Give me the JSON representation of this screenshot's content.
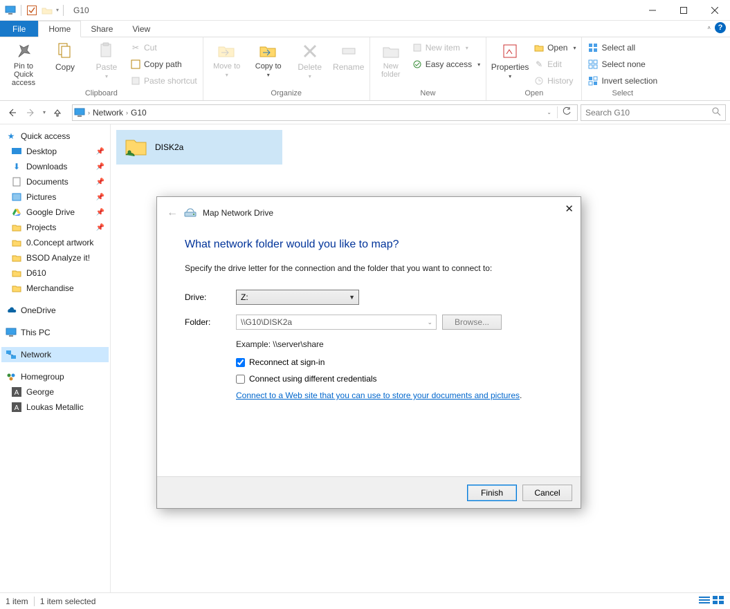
{
  "titlebar": {
    "title": "G10"
  },
  "tabs": {
    "file": "File",
    "home": "Home",
    "share": "Share",
    "view": "View"
  },
  "ribbon": {
    "clipboard": {
      "pin": "Pin to Quick access",
      "copy": "Copy",
      "paste": "Paste",
      "cut": "Cut",
      "copy_path": "Copy path",
      "paste_shortcut": "Paste shortcut",
      "label": "Clipboard"
    },
    "organize": {
      "move": "Move to",
      "copy": "Copy to",
      "delete": "Delete",
      "rename": "Rename",
      "label": "Organize"
    },
    "new": {
      "folder": "New folder",
      "item": "New item",
      "easy": "Easy access",
      "label": "New"
    },
    "open": {
      "properties": "Properties",
      "open": "Open",
      "edit": "Edit",
      "history": "History",
      "label": "Open"
    },
    "select": {
      "all": "Select all",
      "none": "Select none",
      "invert": "Invert selection",
      "label": "Select"
    }
  },
  "address": {
    "network": "Network",
    "node": "G10",
    "search_placeholder": "Search G10"
  },
  "sidebar": {
    "quick": "Quick access",
    "pinned": [
      "Desktop",
      "Downloads",
      "Documents",
      "Pictures",
      "Google Drive",
      "Projects",
      "0.Concept artwork",
      "BSOD Analyze it!",
      "D610",
      "Merchandise"
    ],
    "onedrive": "OneDrive",
    "thispc": "This PC",
    "network": "Network",
    "homegroup": "Homegroup",
    "hg_items": [
      "George",
      "Loukas Metallic"
    ]
  },
  "content": {
    "share_name": "DISK2a"
  },
  "status": {
    "count": "1 item",
    "selected": "1 item selected"
  },
  "dialog": {
    "title": "Map Network Drive",
    "heading": "What network folder would you like to map?",
    "sub": "Specify the drive letter for the connection and the folder that you want to connect to:",
    "drive_label": "Drive:",
    "drive_value": "Z:",
    "folder_label": "Folder:",
    "folder_value": "\\\\G10\\DISK2a",
    "browse": "Browse...",
    "example": "Example: \\\\server\\share",
    "reconnect": "Reconnect at sign-in",
    "diffcred": "Connect using different credentials",
    "link": "Connect to a Web site that you can use to store your documents and pictures",
    "finish": "Finish",
    "cancel": "Cancel"
  }
}
